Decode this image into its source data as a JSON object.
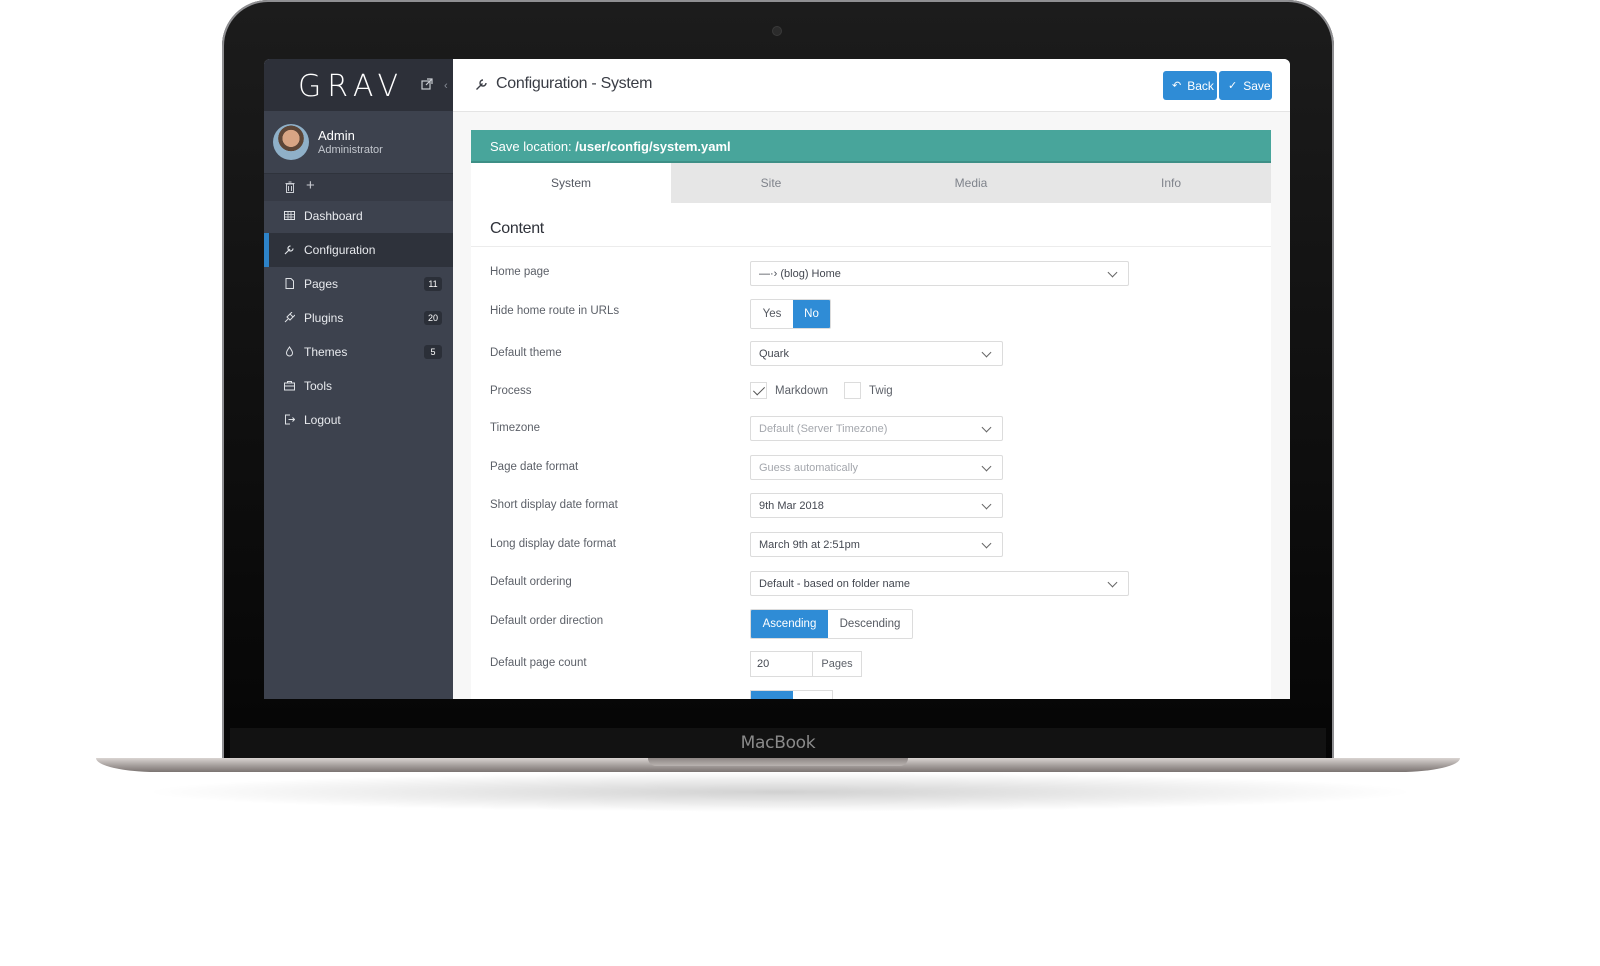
{
  "device": {
    "label": "MacBook"
  },
  "sidebar": {
    "logo": "GRAV",
    "user": {
      "name": "Admin",
      "role": "Administrator"
    },
    "quick_add": "+",
    "items": [
      {
        "label": "Dashboard",
        "icon": "dashboard-icon",
        "badge": ""
      },
      {
        "label": "Configuration",
        "icon": "wrench-icon",
        "badge": "",
        "active": true
      },
      {
        "label": "Pages",
        "icon": "file-icon",
        "badge": "11"
      },
      {
        "label": "Plugins",
        "icon": "plug-icon",
        "badge": "20"
      },
      {
        "label": "Themes",
        "icon": "tint-icon",
        "badge": "5"
      },
      {
        "label": "Tools",
        "icon": "briefcase-icon",
        "badge": ""
      },
      {
        "label": "Logout",
        "icon": "sign-out-icon",
        "badge": ""
      }
    ]
  },
  "header": {
    "title": "Configuration - System",
    "back_label": "Back",
    "save_label": "Save"
  },
  "banner": {
    "prefix": "Save location: ",
    "path": "/user/config/system.yaml"
  },
  "tabs": [
    "System",
    "Site",
    "Media",
    "Info"
  ],
  "active_tab": "System",
  "section": {
    "title": "Content"
  },
  "fields": {
    "home_page": {
      "label": "Home page",
      "value": "—·› (blog) Home"
    },
    "hide_home_route": {
      "label": "Hide home route in URLs",
      "options": [
        "Yes",
        "No"
      ],
      "selected": "No"
    },
    "default_theme": {
      "label": "Default theme",
      "value": "Quark"
    },
    "process": {
      "label": "Process",
      "options": [
        {
          "label": "Markdown",
          "checked": true
        },
        {
          "label": "Twig",
          "checked": false
        }
      ]
    },
    "timezone": {
      "label": "Timezone",
      "placeholder": "Default (Server Timezone)"
    },
    "page_date_format": {
      "label": "Page date format",
      "placeholder": "Guess automatically"
    },
    "short_date_format": {
      "label": "Short display date format",
      "value": "9th Mar 2018"
    },
    "long_date_format": {
      "label": "Long display date format",
      "value": "March 9th at 2:51pm"
    },
    "default_ordering": {
      "label": "Default ordering",
      "value": "Default - based on folder name"
    },
    "order_direction": {
      "label": "Default order direction",
      "options": [
        "Ascending",
        "Descending"
      ],
      "selected": "Ascending"
    },
    "page_count": {
      "label": "Default page count",
      "value": "20",
      "unit": "Pages"
    }
  },
  "colors": {
    "accent": "#2f8cd6",
    "banner": "#48a59b",
    "sidebar": "#3d424e"
  }
}
